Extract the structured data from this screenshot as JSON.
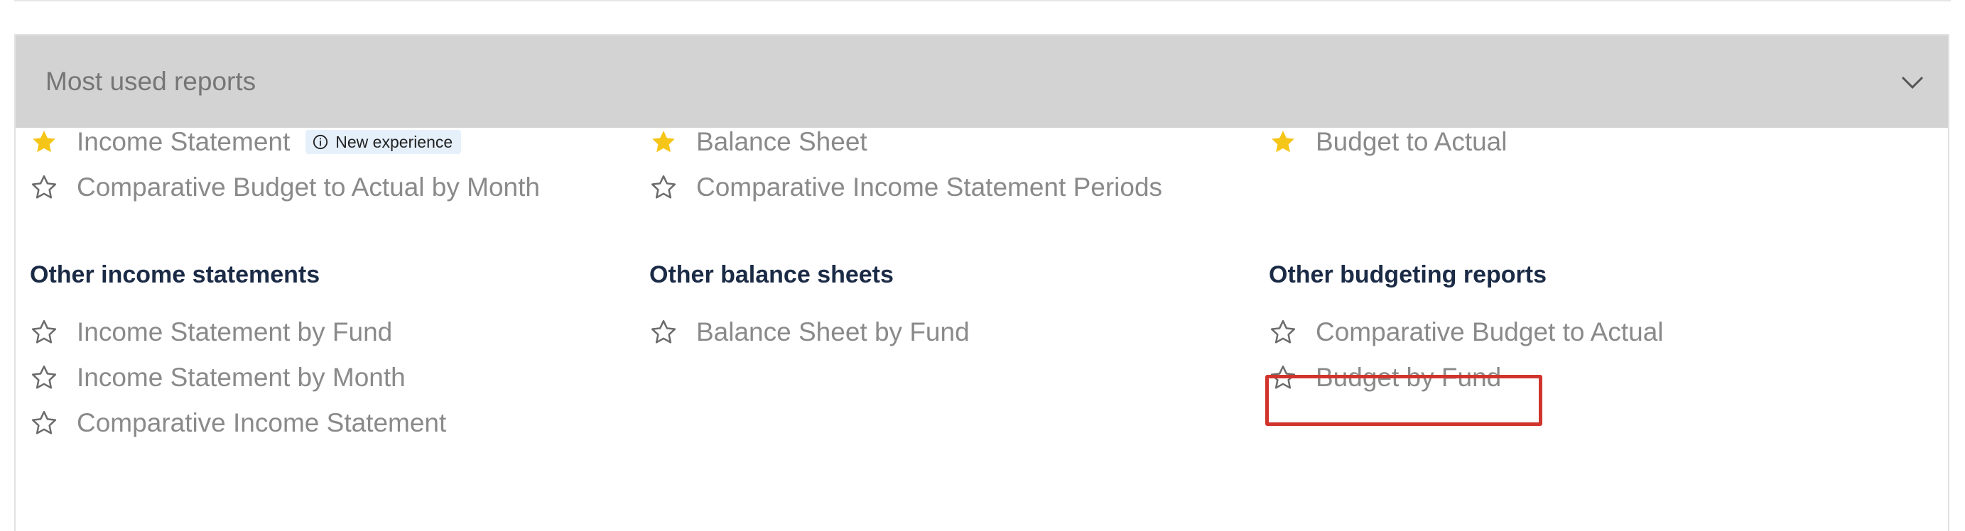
{
  "panel": {
    "title": "Most used reports"
  },
  "columns": [
    {
      "favorites": [
        {
          "label": "Income Statement",
          "starred": true,
          "badge": "New experience"
        },
        {
          "label": "Comparative Budget to Actual by Month",
          "starred": false
        }
      ],
      "section": {
        "heading": "Other income statements",
        "items": [
          "Income Statement by Fund",
          "Income Statement by Month",
          "Comparative Income Statement"
        ]
      }
    },
    {
      "favorites": [
        {
          "label": "Balance Sheet",
          "starred": true
        },
        {
          "label": "Comparative Income Statement Periods",
          "starred": false
        }
      ],
      "section": {
        "heading": "Other balance sheets",
        "items": [
          "Balance Sheet by Fund"
        ]
      }
    },
    {
      "favorites": [
        {
          "label": "Budget to Actual",
          "starred": true
        }
      ],
      "section": {
        "heading": "Other budgeting reports",
        "items": [
          "Comparative Budget to Actual",
          "Budget by Fund"
        ]
      }
    }
  ],
  "colors": {
    "star_filled": "#f5c518",
    "star_outline": "#6b6b6b",
    "heading": "#1b2b46",
    "highlight": "#d0342c"
  }
}
